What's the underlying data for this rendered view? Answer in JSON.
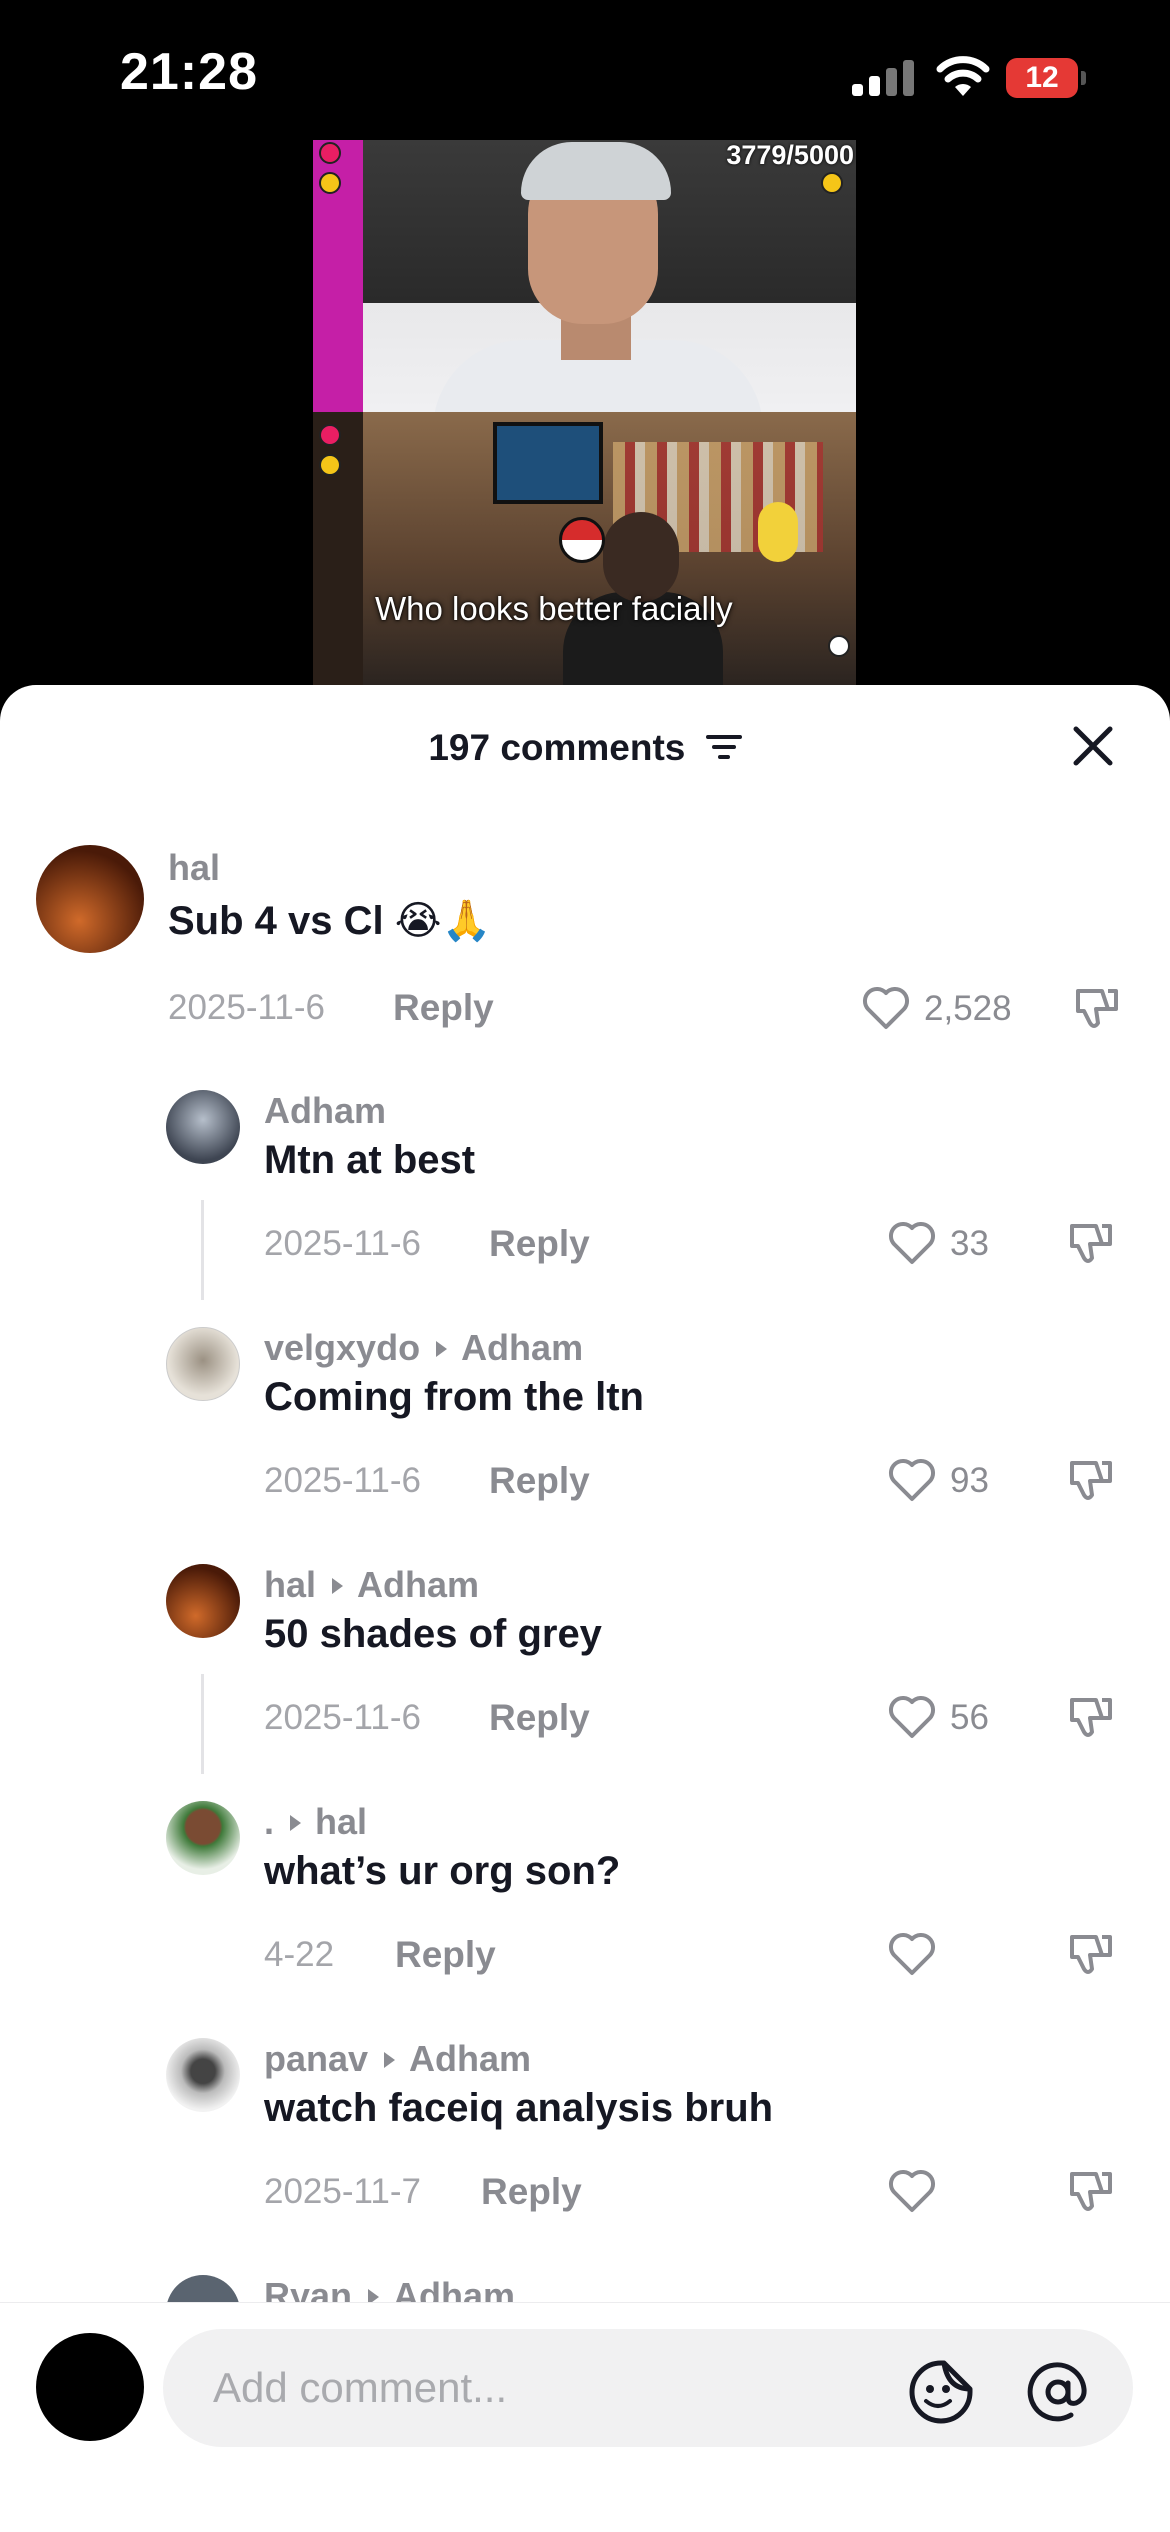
{
  "status_bar": {
    "time": "21:28",
    "battery": "12"
  },
  "video": {
    "counter": "3779/5000",
    "caption": "Who looks better facially"
  },
  "sheet": {
    "title": "197 comments"
  },
  "comments": [
    {
      "user": "hal",
      "text": "Sub 4 vs Cl",
      "emoji": "😭🙏",
      "date": "2025-11-6",
      "reply": "Reply",
      "likes": "2,528"
    },
    {
      "user": "Adham",
      "text": "Mtn at best",
      "date": "2025-11-6",
      "reply": "Reply",
      "likes": "33"
    },
    {
      "user": "velgxydo",
      "to": "Adham",
      "text": "Coming from the ltn",
      "date": "2025-11-6",
      "reply": "Reply",
      "likes": "93"
    },
    {
      "user": "hal",
      "to": "Adham",
      "text": "50 shades of grey",
      "date": "2025-11-6",
      "reply": "Reply",
      "likes": "56"
    },
    {
      "user": ".",
      "to": "hal",
      "text": "what’s ur org son?",
      "date": "4-22",
      "reply": "Reply",
      "likes": ""
    },
    {
      "user": "panav",
      "to": "Adham",
      "text": "watch faceiq analysis bruh",
      "date": "2025-11-7",
      "reply": "Reply",
      "likes": ""
    },
    {
      "user": "Ryan",
      "to": "Adham"
    }
  ],
  "input": {
    "placeholder": "Add comment..."
  },
  "icons": {
    "filter": "filter-icon",
    "close": "close-icon",
    "like": "heart-icon",
    "dislike": "thumbs-down-icon",
    "emoji": "sticker-icon",
    "mention": "at-icon"
  },
  "colors": {
    "battery": "#e53935",
    "text": "#161823",
    "muted": "#8a8b91"
  }
}
